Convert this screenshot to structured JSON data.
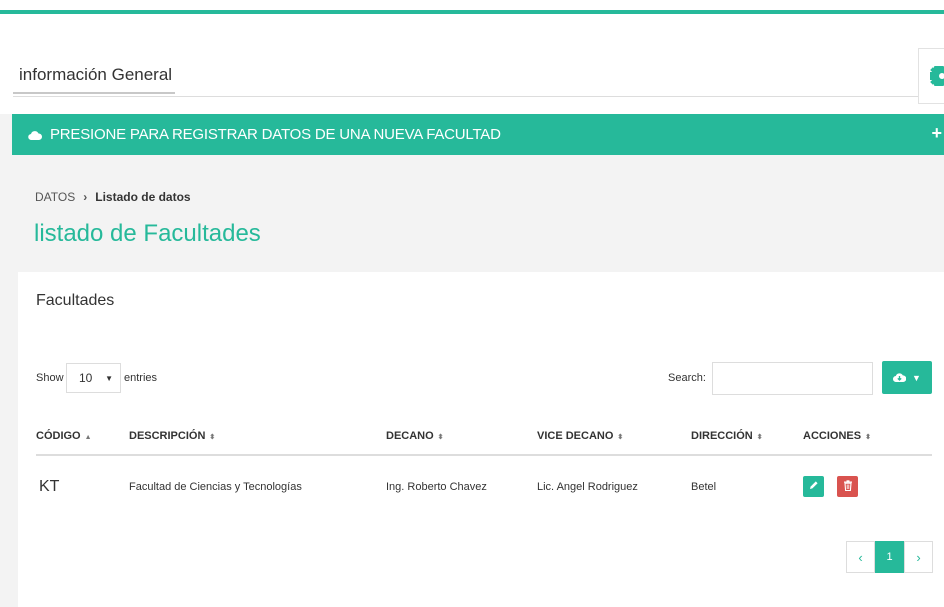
{
  "header": {
    "info_tab": "información General"
  },
  "register_bar": {
    "label": "PRESIONE PARA REGISTRAR DATOS DE UNA NUEVA FACULTAD",
    "plus": "+"
  },
  "breadcrumb": {
    "root": "DATOS",
    "separator": "›",
    "current": "Listado de datos"
  },
  "page_title": "listado de Facultades",
  "panel": {
    "title": "Facultades",
    "show_label": "Show",
    "entries_value": "10",
    "entries_label": "entries",
    "search_label": "Search:",
    "search_value": ""
  },
  "table": {
    "columns": [
      "CÓDIGO",
      "DESCRIPCIÓN",
      "DECANO",
      "VICE DECANO",
      "DIRECCIÓN",
      "ACCIONES"
    ],
    "rows": [
      {
        "code": "KT",
        "description": "Facultad de Ciencias y Tecnologías",
        "dean": "Ing. Roberto Chavez",
        "vice_dean": "Lic. Angel Rodriguez",
        "address": "Betel"
      }
    ]
  },
  "pagination": {
    "prev": "‹",
    "page": "1",
    "next": "›"
  },
  "colors": {
    "accent": "#26b99a",
    "danger": "#d9534f"
  },
  "icons": [
    "gear-icon",
    "cloud-icon",
    "cloud-download-icon",
    "pencil-icon",
    "trash-icon",
    "chevron-left-icon",
    "chevron-right-icon"
  ]
}
